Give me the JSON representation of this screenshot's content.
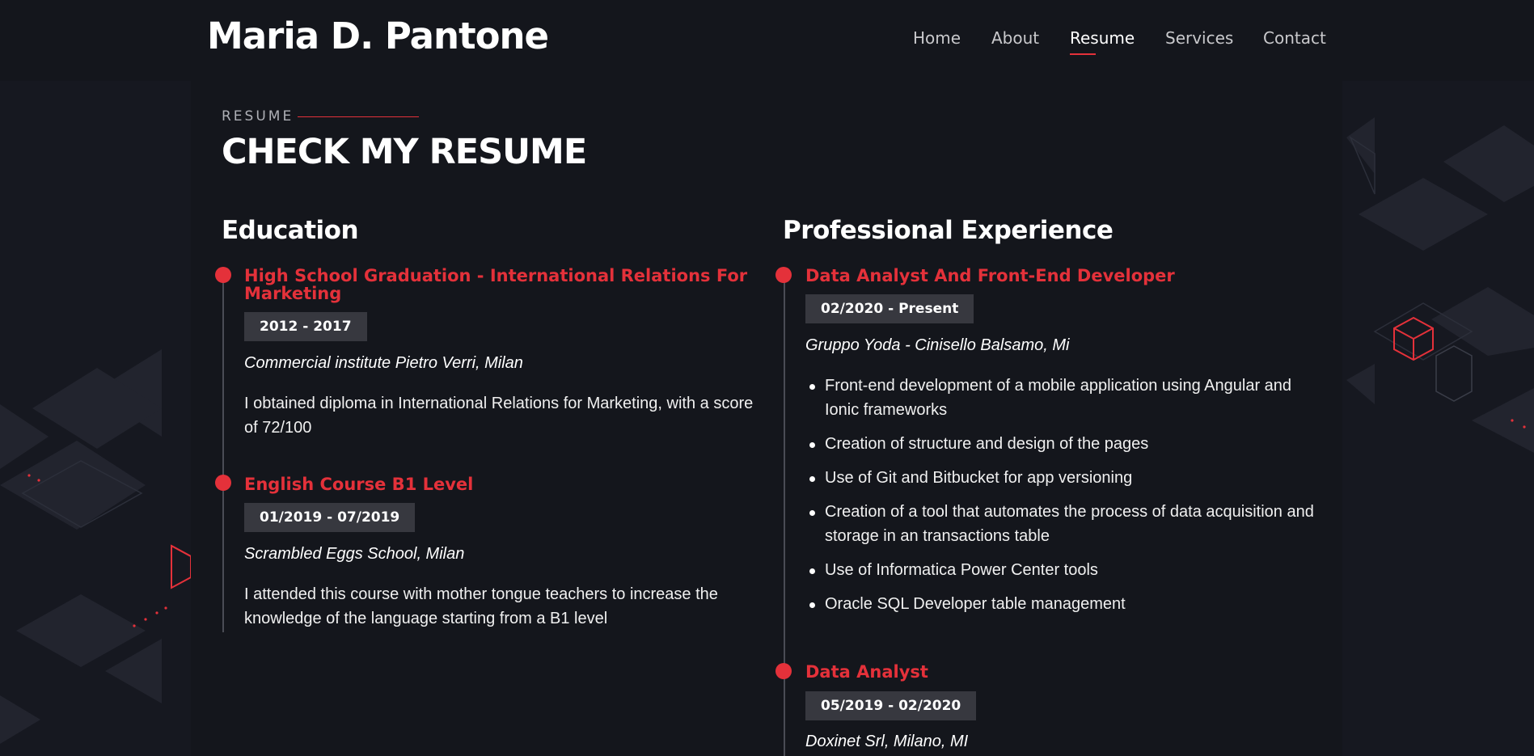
{
  "header": {
    "brand": "Maria D. Pantone",
    "nav": [
      {
        "label": "Home",
        "active": false
      },
      {
        "label": "About",
        "active": false
      },
      {
        "label": "Resume",
        "active": true
      },
      {
        "label": "Services",
        "active": false
      },
      {
        "label": "Contact",
        "active": false
      }
    ]
  },
  "section": {
    "label": "RESUME",
    "title": "CHECK MY RESUME"
  },
  "education": {
    "title": "Education",
    "items": [
      {
        "title": "High School Graduation - International Relations For Marketing",
        "date": "2012 - 2017",
        "place": "Commercial institute Pietro Verri, Milan",
        "description": "I obtained diploma in International Relations for Marketing, with a score of 72/100"
      },
      {
        "title": "English Course B1 Level",
        "date": "01/2019 - 07/2019",
        "place": "Scrambled Eggs School, Milan",
        "description": "I attended this course with mother tongue teachers to increase the knowledge of the language starting from a B1 level"
      }
    ]
  },
  "experience": {
    "title": "Professional Experience",
    "items": [
      {
        "title": "Data Analyst And Front-End Developer",
        "date": "02/2020 - Present",
        "place": "Gruppo Yoda - Cinisello Balsamo, Mi",
        "bullets": [
          "Front-end development of a mobile application using Angular and Ionic frameworks",
          "Creation of structure and design of the pages",
          "Use of Git and Bitbucket for app versioning",
          "Creation of a tool that automates the process of data acquisition and storage in an transactions table",
          "Use of Informatica Power Center tools",
          "Oracle SQL Developer table management"
        ]
      },
      {
        "title": "Data Analyst",
        "date": "05/2019 - 02/2020",
        "place": "Doxinet Srl, Milano, MI"
      }
    ]
  },
  "colors": {
    "accent": "#e4313a",
    "background": "#14161c",
    "badge": "#37383f",
    "text": "#ffffff"
  }
}
